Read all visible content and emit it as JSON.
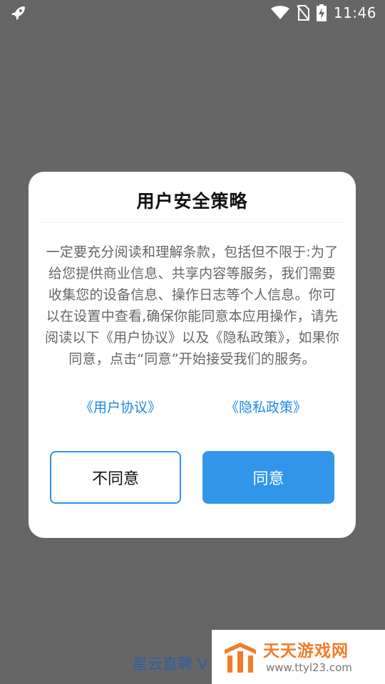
{
  "status_bar": {
    "time": "11:46",
    "left_icon": "rocket-icon",
    "icons": [
      "wifi-icon",
      "no-sim-icon",
      "battery-charging-icon"
    ]
  },
  "dialog": {
    "title": "用户安全策略",
    "body": "一定要充分阅读和理解条款，包括但不限于:为了给您提供商业信息、共享内容等服务，我们需要收集您的设备信息、操作日志等个人信息。你可以在设置中查看,确保你能同意本应用操作，请先阅读以下《用户协议》以及《隐私政策》，如果你同意，点击“同意”开始接受我们的服务。",
    "links": {
      "user_agreement": "《用户协议》",
      "privacy_policy": "《隐私政策》"
    },
    "buttons": {
      "disagree": "不同意",
      "agree": "同意"
    }
  },
  "background": {
    "app_name": "星云直聘 V"
  },
  "watermark": {
    "title": "天天游戏网",
    "url": "www.ttyl23.com"
  },
  "colors": {
    "overlay": "#666666",
    "accent": "#3196ea",
    "link": "#1e88e5",
    "watermark_orange": "#f07c2a"
  }
}
